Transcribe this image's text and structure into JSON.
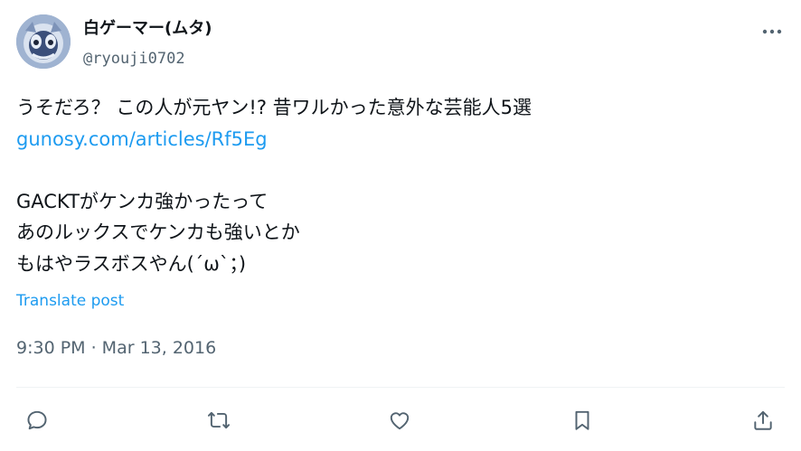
{
  "author": {
    "display_name": "白ゲーマー(ムタ)",
    "handle": "@ryouji0702",
    "avatar": "avatar-character-icon"
  },
  "header": {
    "more_icon": "more-options-icon"
  },
  "tweet": {
    "lines": [
      "うそだろ？ この人が元ヤン!? 昔ワルかった意外な芸能人5選",
      "GACKTがケンカ強かったって",
      "あのルックスでケンカも強いとか",
      "もはやラスボスやん(´ω`；)"
    ],
    "link": "gunosy.com/articles/Rf5Eg",
    "translate_label": "Translate post",
    "timestamp": "9:30 PM · Mar 13, 2016"
  },
  "actions": [
    {
      "name": "reply",
      "icon": "reply-icon"
    },
    {
      "name": "retweet",
      "icon": "retweet-icon"
    },
    {
      "name": "like",
      "icon": "heart-icon"
    },
    {
      "name": "bookmark",
      "icon": "bookmark-icon"
    },
    {
      "name": "share",
      "icon": "share-icon"
    }
  ],
  "colors": {
    "text": "#0f1419",
    "secondary": "#536471",
    "link": "#1d9bf0",
    "divider": "#eff3f4"
  }
}
